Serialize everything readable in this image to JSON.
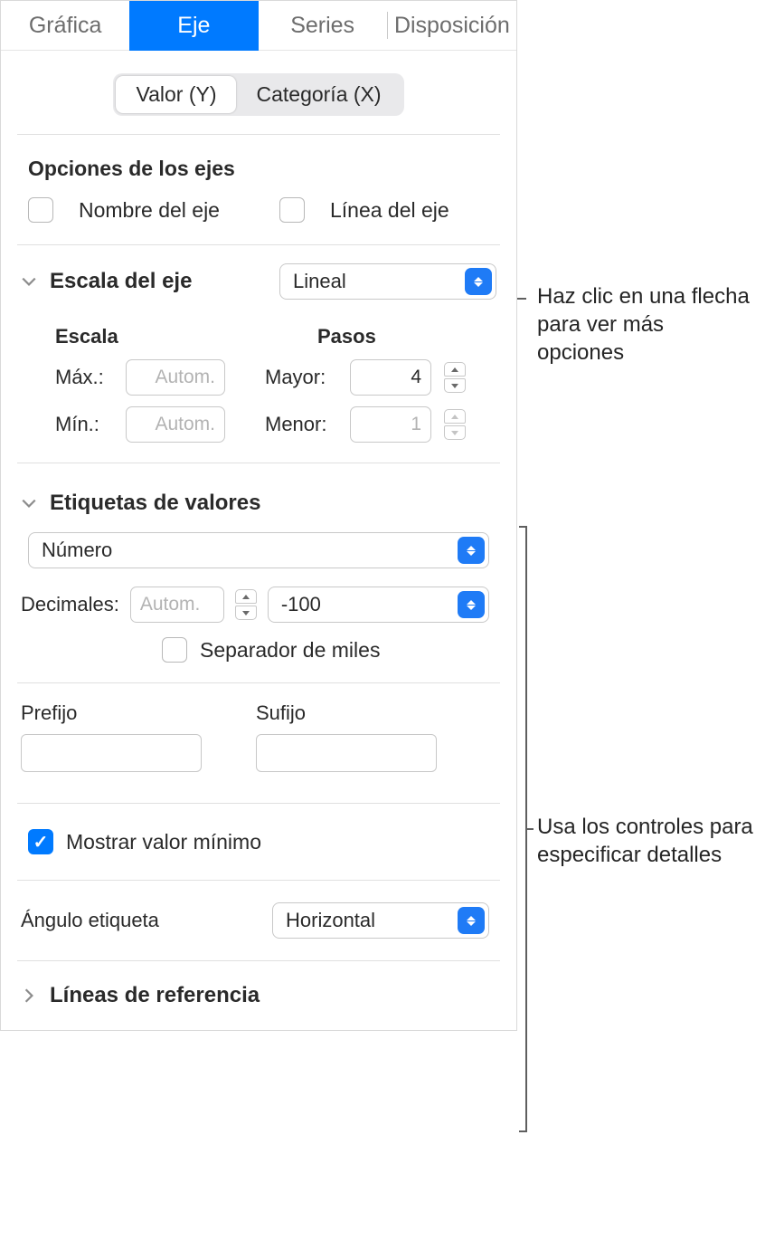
{
  "topnav": {
    "tabs": [
      "Gráfica",
      "Eje",
      "Series",
      "Disposición"
    ],
    "active": 1
  },
  "subtabs": {
    "options": [
      "Valor (Y)",
      "Categoría (X)"
    ],
    "active": 0
  },
  "axisOptions": {
    "title": "Opciones de los ejes",
    "nameLabel": "Nombre del eje",
    "lineLabel": "Línea del eje"
  },
  "axisScale": {
    "title": "Escala del eje",
    "typeValue": "Lineal",
    "scaleHdr": "Escala",
    "stepsHdr": "Pasos",
    "maxLabel": "Máx.:",
    "minLabel": "Mín.:",
    "autoPlaceholder": "Autom.",
    "majorLabel": "Mayor:",
    "minorLabel": "Menor:",
    "majorValue": "4",
    "minorValue": "1"
  },
  "valueLabels": {
    "title": "Etiquetas de valores",
    "formatValue": "Número",
    "decimalsLabel": "Decimales:",
    "decimalsPlaceholder": "Autom.",
    "negFormat": "-100",
    "thousandsLabel": "Separador de miles",
    "prefixLabel": "Prefijo",
    "suffixLabel": "Sufijo",
    "showMinLabel": "Mostrar valor mínimo",
    "angleLabel": "Ángulo etiqueta",
    "angleValue": "Horizontal"
  },
  "refLines": {
    "title": "Líneas de referencia"
  },
  "callouts": {
    "c1": "Haz clic en una flecha para ver más opciones",
    "c2": "Usa los controles para especificar detalles"
  }
}
